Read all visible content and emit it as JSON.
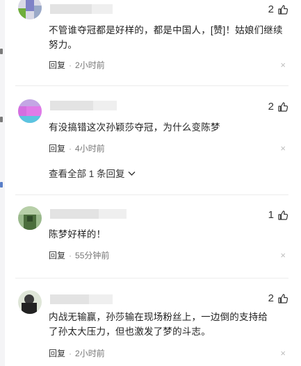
{
  "comments": [
    {
      "likes": "2",
      "text": "不管谁夺冠都是好样的，都是中国人，[赞]！姑娘们继续努力。",
      "reply_label": "回复",
      "time": "2小时前",
      "close": "×"
    },
    {
      "likes": "2",
      "text": "有没搞错这次孙颖莎夺冠，为什么变陈梦",
      "reply_label": "回复",
      "time": "4小时前",
      "close": "×"
    },
    {
      "likes": "1",
      "text": "陈梦好样的！",
      "reply_label": "回复",
      "time": "55分钟前",
      "close": "×"
    },
    {
      "likes": "2",
      "text_line1": "内战无输赢，孙莎输在现场粉丝上，一边倒的支持给",
      "text_line2": "了孙太大压力，但也激发了梦的斗志。",
      "reply_label": "回复",
      "time": "2小时前",
      "close": "×"
    }
  ],
  "view_all": {
    "label": "查看全部 1 条回复"
  },
  "colors": {
    "page_background": "#ffffff",
    "text": "#222222",
    "meta": "#777777",
    "divider": "#ececec"
  },
  "icons": {
    "like": "thumbs-up-icon",
    "close": "close-icon",
    "expand": "chevron-down-icon"
  }
}
